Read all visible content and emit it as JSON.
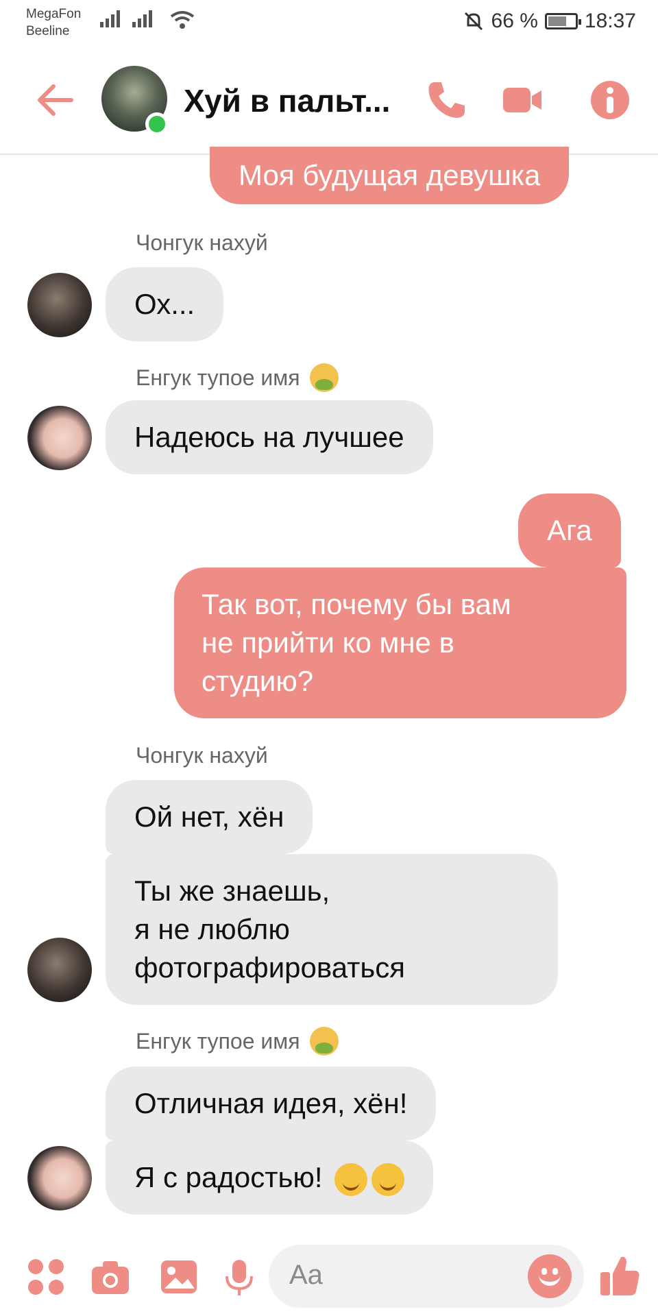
{
  "status": {
    "carrier1": "MegaFon",
    "carrier2": "Beeline",
    "battery": "66 %",
    "time": "18:37"
  },
  "header": {
    "title": "Хуй в пальт..."
  },
  "colors": {
    "accent": "#ee8c86",
    "incoming": "#e9e8ea",
    "online": "#33c24d"
  },
  "messages": {
    "m1": "Моя будущая девушка",
    "s1": "Чонгук нахуй",
    "m2": "Ох...",
    "s2": "Енгук тупое имя",
    "m3": "Надеюсь на лучшее",
    "m4": "Ага",
    "m5_l1": "Так вот, почему бы вам",
    "m5_l2": "не прийти ко мне в",
    "m5_l3": "студию?",
    "s3": "Чонгук нахуй",
    "m6": "Ой нет, хён",
    "m7_l1": "Ты же знаешь,",
    "m7_l2": "я не люблю",
    "m7_l3": "фотографироваться",
    "s4": "Енгук тупое имя",
    "m8": "Отличная идея, хён!",
    "m9": "Я с радостью!"
  },
  "composer": {
    "placeholder": "Aa"
  }
}
